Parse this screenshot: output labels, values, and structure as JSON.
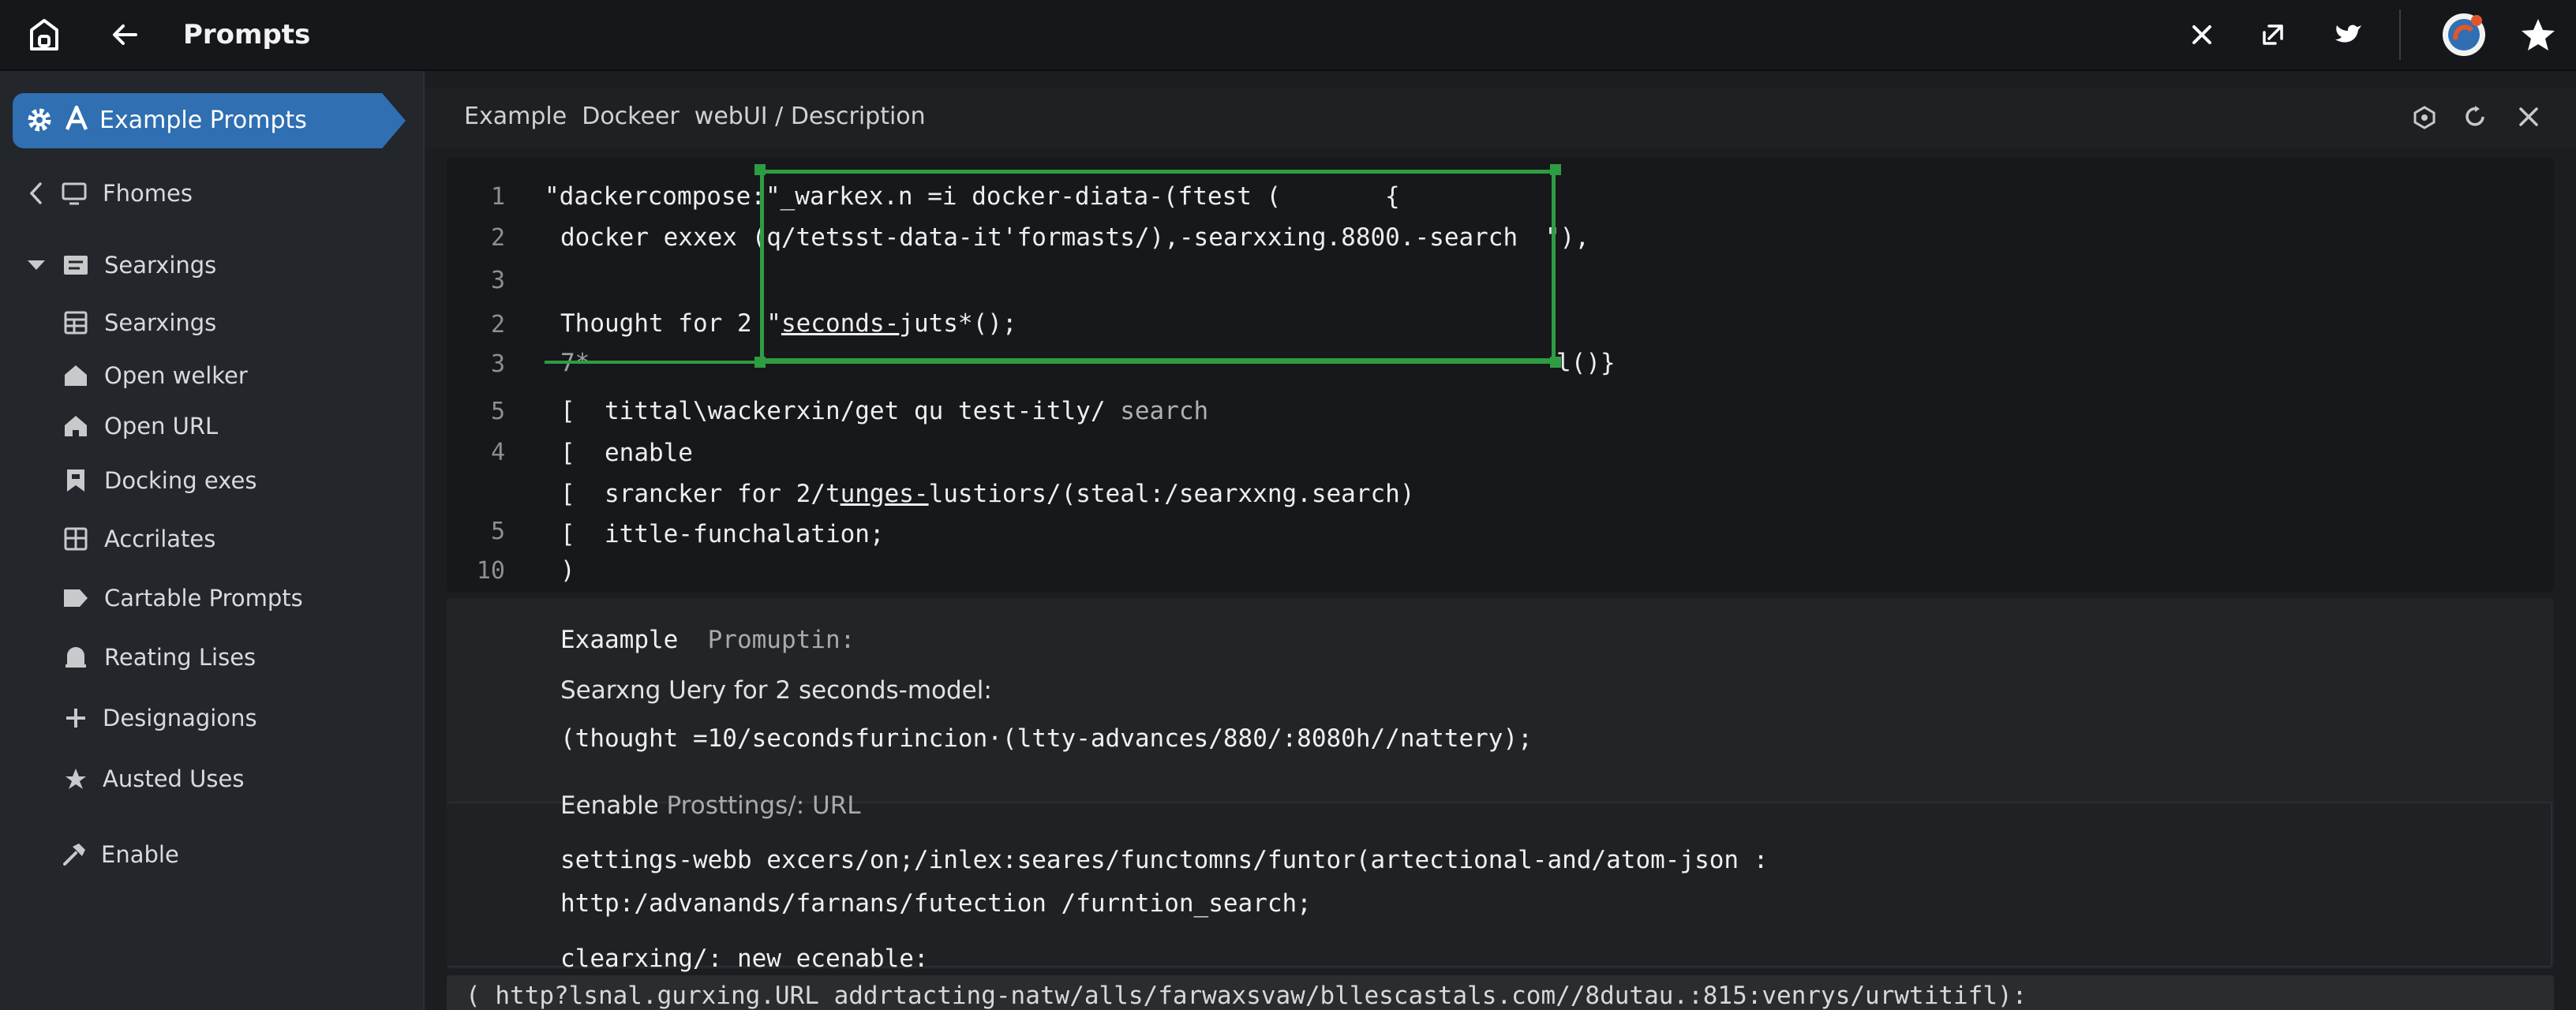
{
  "topbar": {
    "title": "Prompts"
  },
  "sidebar": {
    "active": "Example Prompts",
    "items": [
      {
        "label": "Fhomes",
        "icon": "monitor-icon"
      },
      {
        "label": "Searxings",
        "icon": "list-icon"
      },
      {
        "label": "Searxings",
        "icon": "grid-icon"
      },
      {
        "label": "Open welker",
        "icon": "home-icon"
      },
      {
        "label": "Open URL",
        "icon": "home-icon"
      },
      {
        "label": "Docking exes",
        "icon": "bookmark-icon"
      },
      {
        "label": "Accrilates",
        "icon": "grid-icon"
      },
      {
        "label": "Cartable Prompts",
        "icon": "tag-icon"
      },
      {
        "label": "Reating Lises",
        "icon": "bell-icon"
      },
      {
        "label": "Designagions",
        "icon": "plus-icon"
      },
      {
        "label": "Austed Uses",
        "icon": "pin-icon"
      },
      {
        "label": "Enable",
        "icon": "hammer-icon"
      }
    ]
  },
  "breadcrumb": "Example  Dockeer  webUI / Description",
  "editor": {
    "line_numbers": [
      "1",
      "2",
      "3",
      "4",
      "5",
      "4",
      "5",
      "10"
    ],
    "l1a": "\"dackercompose:\"_warkex.n =i docker-diata-(ftest (",
    "l1b": "{",
    "l2": "docker exxex (q/tetsst-data-it'formasts/),-searxxing.8800.-search",
    "l2b": "\"),",
    "l3a": "Thought for 2 \"",
    "l3u": "seconds-",
    "l3b": "juts*();",
    "l4a": "7*",
    "l4b": "l()}",
    "l5a": "[  tittal\\wackerxin/get qu test-itly/",
    "l5b": " search",
    "l6": "[  enable",
    "l7a": "[  srancker for 2/t",
    "l7u": "unges-",
    "l7b": "lustiors/(steal:/searxxng.search)",
    "l8": "[  ittle-funchalation;",
    "l9": ")"
  },
  "panel": {
    "example_label": "Exaample",
    "example_sub": "Promuptin:",
    "line1": "Searxng Uery for 2 seconds-model:",
    "line2": "(thought =10/secondsfurincion·(ltty-advances/880/:8080h//nattery);",
    "enable_label": "Eenable",
    "enable_sub": "Prosttings/: URL",
    "line3": "settings-webb excers/on;/inlex:seares/functomns/funtor(artectional-and/atom-json :",
    "line4": "http:/advanands/farnans/futection /furntion_search;",
    "line5": "clearxing/: new ecenable:"
  },
  "bottom": "( http?lsnal.gurxing.URL addrtacting-natw/alls/farwaxsvaw/bllescastals.com//8dutau.:815:venrys/urwtitifl):",
  "colors": {
    "accent": "#2f6fb2",
    "selection": "#2e9c43",
    "avatar": "#e2572a"
  }
}
